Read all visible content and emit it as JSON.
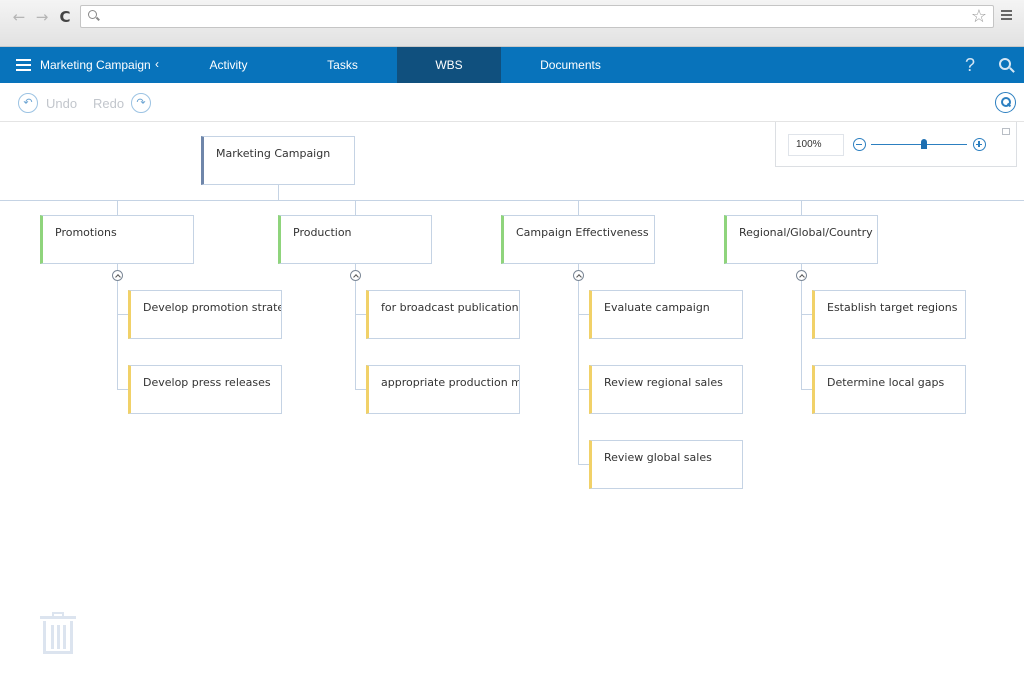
{
  "browser": {
    "back_icon": "←",
    "forward_icon": "→",
    "reload_icon": "C",
    "address_value": "",
    "bookmark_icon": "☆"
  },
  "appbar": {
    "project_title": "Marketing Campaign",
    "collapse_icon": "‹",
    "tabs": [
      {
        "label": "Activity",
        "active": false
      },
      {
        "label": "Tasks",
        "active": false
      },
      {
        "label": "WBS",
        "active": true
      },
      {
        "label": "Documents",
        "active": false
      }
    ],
    "help_icon": "?",
    "colors": {
      "bar": "#0873bb",
      "active_tab": "#10507e"
    }
  },
  "toolbar": {
    "undo_label": "Undo",
    "redo_label": "Redo",
    "undo_icon": "↶",
    "redo_icon": "↷"
  },
  "zoom": {
    "value": "100%",
    "level_fraction": 0.55
  },
  "wbs": {
    "root": {
      "label": "Marketing Campaign"
    },
    "groups": [
      {
        "label": "Promotions",
        "children": [
          "Develop promotion strategy",
          "Develop press releases"
        ]
      },
      {
        "label": "Production",
        "children": [
          "for broadcast publications",
          "appropriate production me..."
        ]
      },
      {
        "label": "Campaign Effectiveness",
        "children": [
          "Evaluate campaign",
          "Review regional sales",
          "Review global sales"
        ]
      },
      {
        "label": "Regional/Global/Country Bu...",
        "children": [
          "Establish target regions",
          "Determine local gaps"
        ]
      }
    ],
    "colors": {
      "root_accent": "#6f86aa",
      "level1_accent": "#8fd47c",
      "level2_accent": "#f1d168",
      "connector": "#c5d3e4"
    }
  }
}
